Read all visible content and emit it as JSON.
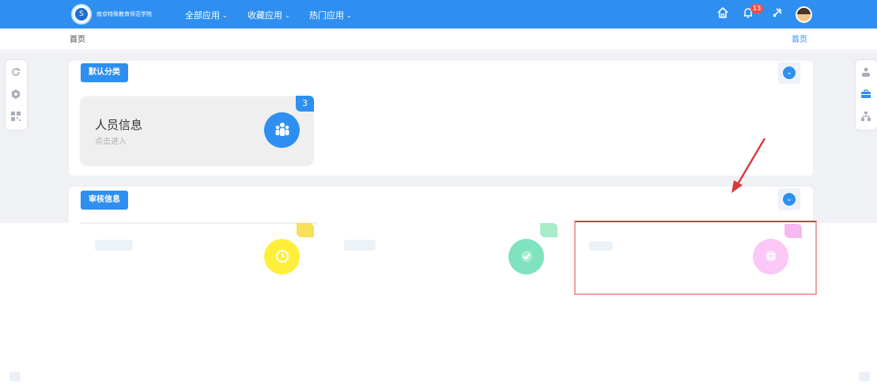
{
  "header": {
    "logo_text": "南京特殊教育师范学院",
    "nav": [
      {
        "label": "全部应用"
      },
      {
        "label": "收藏应用"
      },
      {
        "label": "热门应用"
      }
    ],
    "notification_count": "13",
    "icons": [
      "home-icon",
      "bell-icon",
      "tools-icon",
      "avatar"
    ]
  },
  "breadcrumb": {
    "left": "首页",
    "right": "首页"
  },
  "sections": [
    {
      "tag": "默认分类",
      "cards": [
        {
          "title": "人员信息",
          "subtitle": "点击进入",
          "count": "3",
          "icon": "people-icon"
        }
      ]
    },
    {
      "tag": "审核信息",
      "cards": [
        {
          "icon": "clock-icon",
          "accent": "#ffe600"
        },
        {
          "icon": "check-icon",
          "accent": "#52d6a6"
        },
        {
          "icon": "mail-icon",
          "accent": "#f7a8f2"
        }
      ]
    }
  ],
  "left_toolbar": [
    "refresh-icon",
    "settings-icon",
    "grid-icon"
  ],
  "right_toolbar": [
    "users-icon",
    "briefcase-icon",
    "org-chart-icon"
  ],
  "colors": {
    "primary": "#2e8ff0",
    "badge_red": "#f0524a",
    "annotation_red": "#d9383a"
  }
}
